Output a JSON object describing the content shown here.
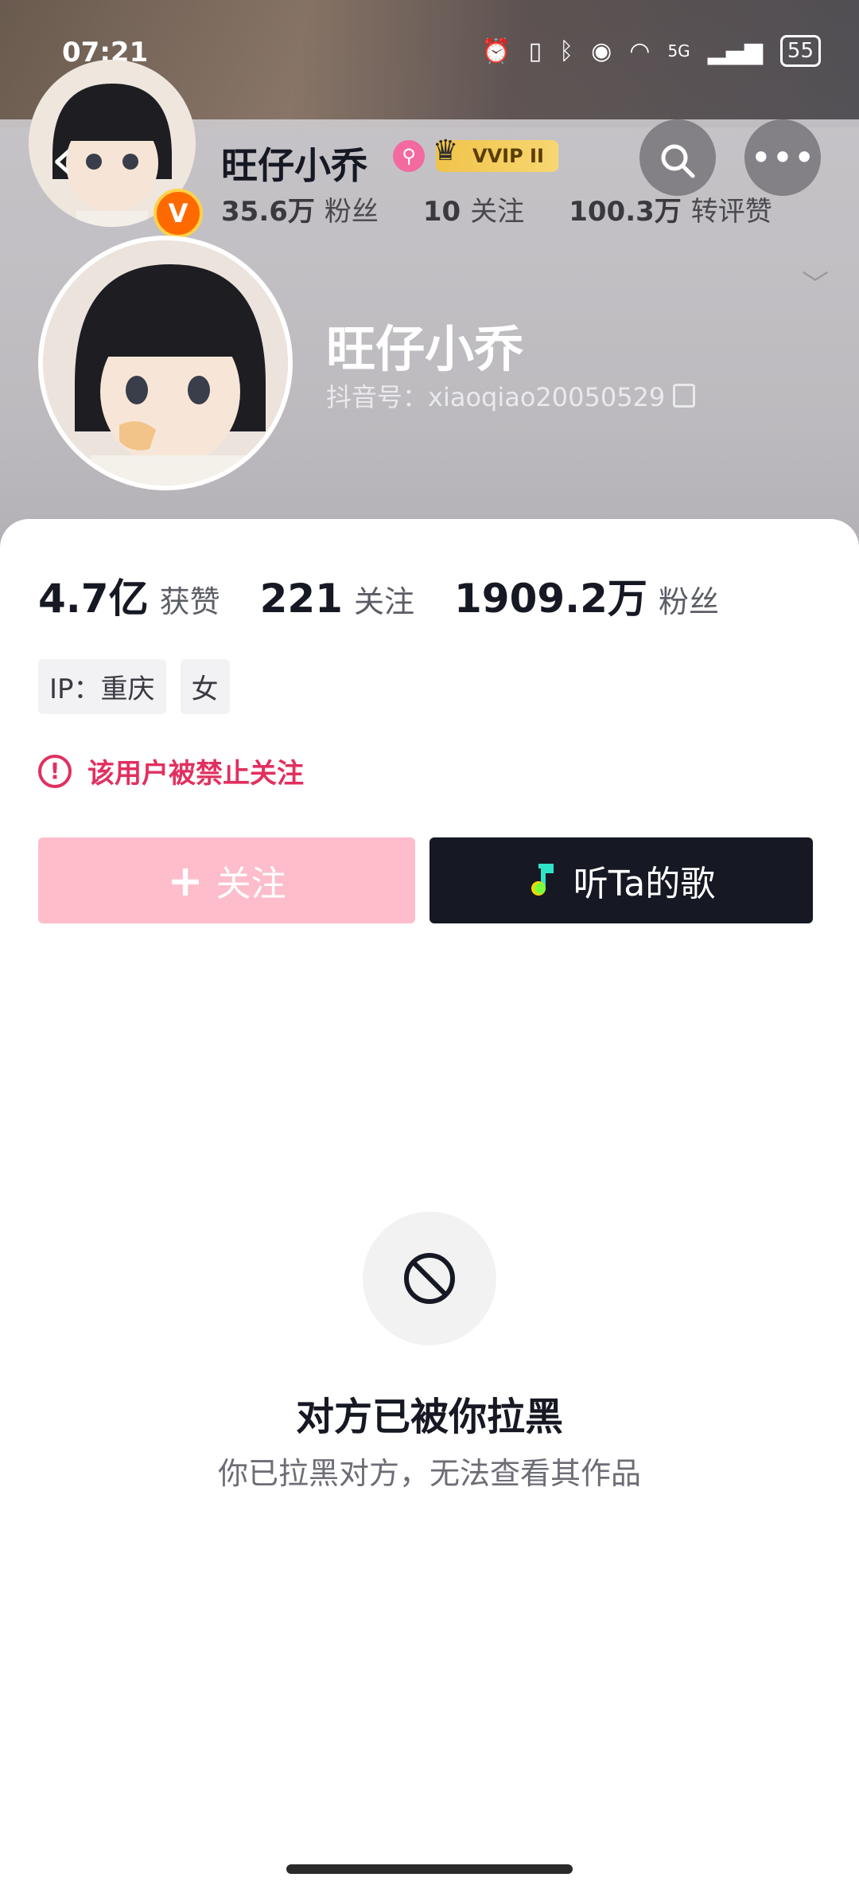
{
  "status_bar": {
    "time": "07:21",
    "signal": "5G",
    "battery": "55"
  },
  "header": {
    "name": "旺仔小乔",
    "vip_label": "VVIP II",
    "stats": [
      {
        "value": "35.6万",
        "label": "粉丝"
      },
      {
        "value": "10",
        "label": "关注"
      },
      {
        "value": "100.3万",
        "label": "转评赞"
      }
    ]
  },
  "profile": {
    "name": "旺仔小乔",
    "douyin_id": "抖音号：xiaoqiao20050529"
  },
  "stats": [
    {
      "value": "4.7亿",
      "label": "获赞"
    },
    {
      "value": "221",
      "label": "关注"
    },
    {
      "value": "1909.2万",
      "label": "粉丝"
    }
  ],
  "tags": [
    "IP：重庆",
    "女"
  ],
  "ban_notice": "该用户被禁止关注",
  "buttons": {
    "follow": "关注",
    "song": "听Ta的歌"
  },
  "blocked": {
    "title": "对方已被你拉黑",
    "subtitle": "你已拉黑对方，无法查看其作品"
  },
  "colors": {
    "accent_pink": "#fdbdca",
    "warning": "#e1305f",
    "dark": "#161823"
  }
}
